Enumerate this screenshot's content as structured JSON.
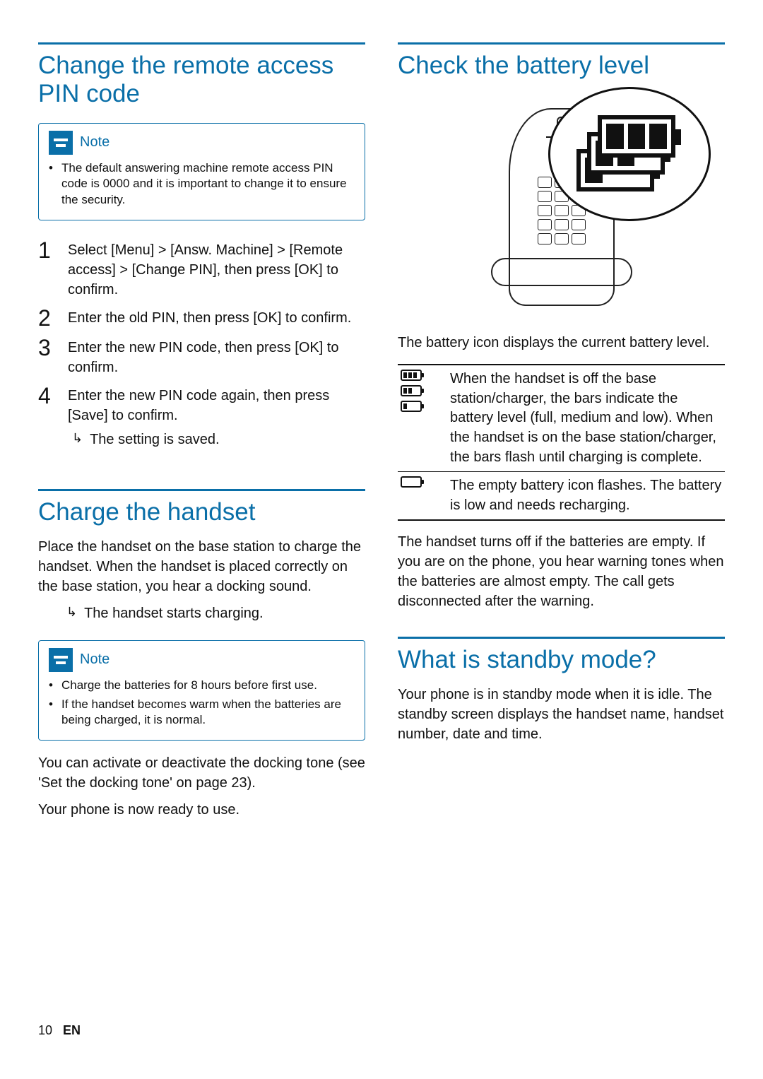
{
  "footer": {
    "page": "10",
    "lang": "EN"
  },
  "left": {
    "s1": {
      "title": "Change the remote access PIN code",
      "note_label": "Note",
      "note_items": [
        "The default answering machine remote access PIN code is 0000 and it is important to change it to ensure the security."
      ],
      "steps": [
        {
          "num": "1",
          "text": "Select [Menu] > [Answ. Machine] > [Remote access] > [Change PIN], then press [OK] to confirm."
        },
        {
          "num": "2",
          "text": "Enter the old PIN, then press [OK] to confirm."
        },
        {
          "num": "3",
          "text": "Enter the new PIN code, then press [OK] to confirm."
        },
        {
          "num": "4",
          "text": "Enter the new PIN code again, then press [Save] to confirm.",
          "result": "The setting is saved."
        }
      ]
    },
    "s2": {
      "title": "Charge the handset",
      "intro": "Place the handset on the base station to charge the handset. When the handset is placed correctly on the base station, you hear a docking sound.",
      "result": "The handset starts charging.",
      "note_label": "Note",
      "note_items": [
        "Charge the batteries for 8 hours before first use.",
        "If the handset becomes warm when the batteries are being charged, it is normal."
      ],
      "after_note_1": "You can activate or deactivate the docking tone (see 'Set the docking tone' on page 23).",
      "after_note_2": "Your phone is now ready to use."
    }
  },
  "right": {
    "s3": {
      "title": "Check the battery level",
      "caption": "The battery icon displays the current battery level.",
      "rows": [
        {
          "icons": 3,
          "text": "When the handset is off the base station/charger, the bars indicate the battery level (full, medium and low). When the handset is on the base station/charger, the bars flash until charging is complete."
        },
        {
          "icons": 1,
          "empty": true,
          "text": "The empty battery icon flashes. The battery is low and needs recharging."
        }
      ],
      "tail": "The handset turns off if the batteries are empty. If you are on the phone, you hear warning tones when the batteries are almost empty. The call gets disconnected after the warning."
    },
    "s4": {
      "title": "What is standby mode?",
      "body": "Your phone is in standby mode when it is idle. The standby screen displays the handset name, handset number, date and time."
    }
  }
}
